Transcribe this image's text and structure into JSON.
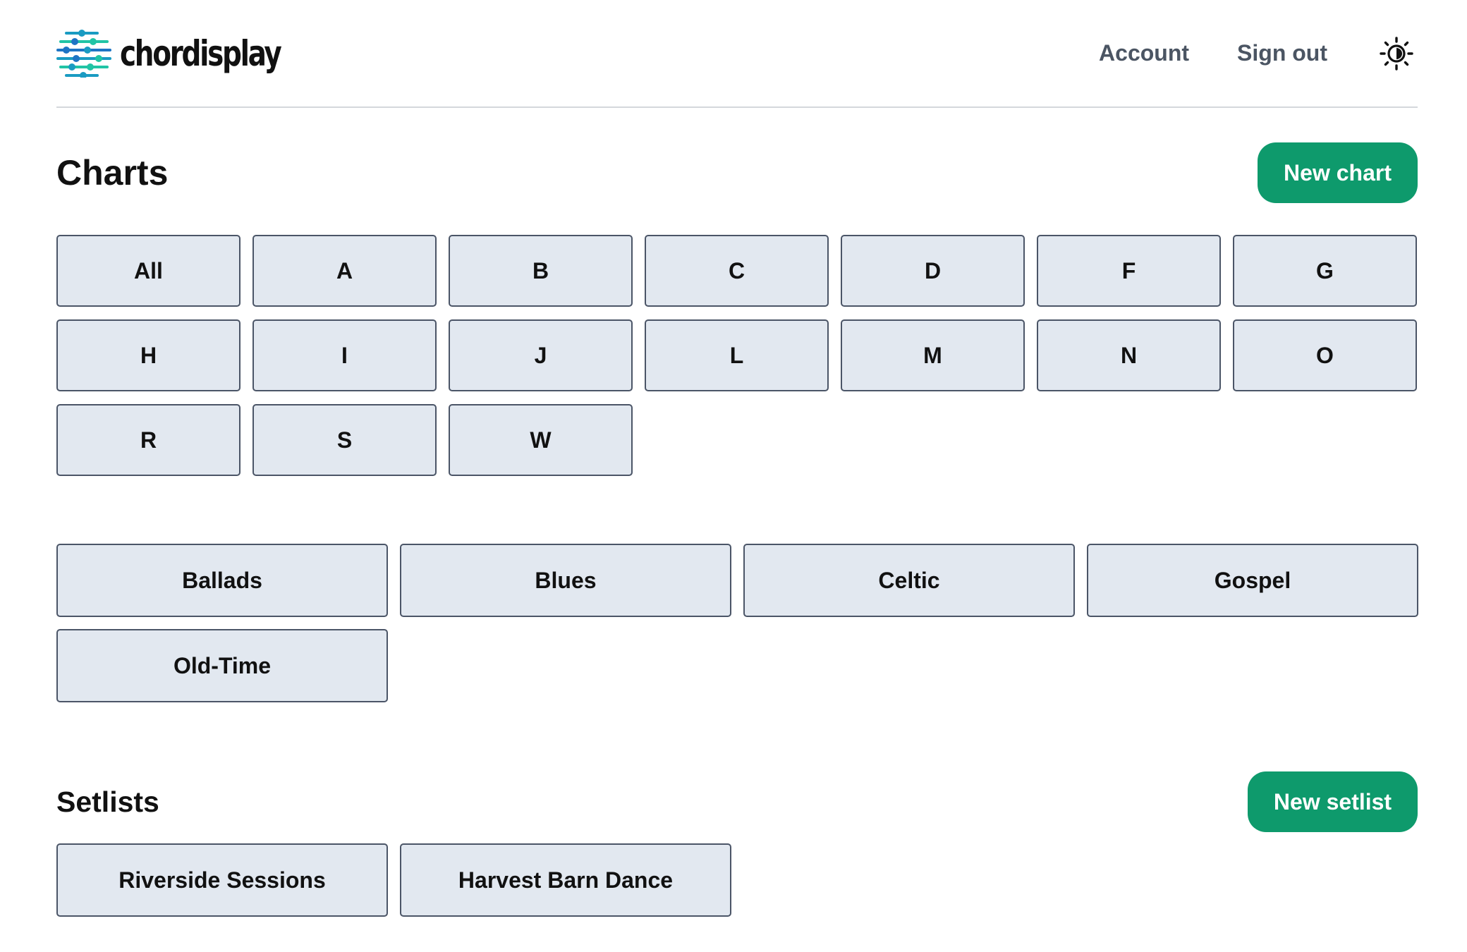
{
  "brand": {
    "name": "chordisplay",
    "colors": [
      "#1e74c4",
      "#1a9bc2",
      "#21c4a5"
    ]
  },
  "nav": {
    "account": "Account",
    "sign_out": "Sign out",
    "theme_icon": "sun-icon"
  },
  "charts": {
    "title": "Charts",
    "new_button": "New chart",
    "letters": [
      "All",
      "A",
      "B",
      "C",
      "D",
      "F",
      "G",
      "H",
      "I",
      "J",
      "L",
      "M",
      "N",
      "O",
      "R",
      "S",
      "W"
    ],
    "genres": [
      "Ballads",
      "Blues",
      "Celtic",
      "Gospel",
      "Old-Time"
    ]
  },
  "setlists": {
    "title": "Setlists",
    "new_button": "New setlist",
    "items": [
      "Riverside Sessions",
      "Harvest Barn Dance"
    ]
  },
  "colors": {
    "accent": "#0e9a6c",
    "tile_bg": "#e2e8f0",
    "tile_border": "#4b5567",
    "nav_text": "#4b5563"
  }
}
